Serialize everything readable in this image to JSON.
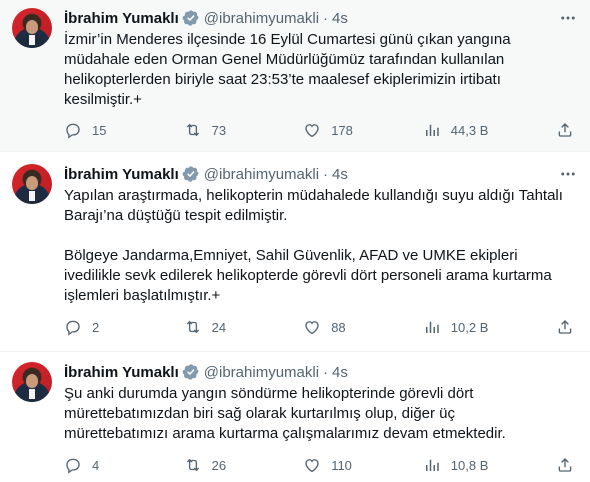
{
  "colors": {
    "text": "#0f1419",
    "muted": "#536471",
    "verified": "#829aab",
    "highlight_bg": "#f7f9f9"
  },
  "icons": {
    "reply": "reply-icon",
    "retweet": "retweet-icon",
    "like": "heart-icon",
    "views": "analytics-icon",
    "share": "share-icon",
    "more": "more-icon",
    "verified": "verified-badge-icon"
  },
  "tweets": [
    {
      "name": "İbrahim Yumaklı",
      "handle": "@ibrahimyumakli",
      "dot": "·",
      "time": "4s",
      "text": "İzmir’in Menderes ilçesinde 16 Eylül Cumartesi günü çıkan yangına\nmüdahale eden Orman Genel Müdürlüğümüz tarafından kullanılan\nhelikopterlerden biriyle saat 23:53’te maalesef ekiplerimizin irtibatı\nkesilmiştir.+",
      "replies": "15",
      "retweets": "73",
      "likes": "178",
      "views": "44,3 B"
    },
    {
      "name": "İbrahim Yumaklı",
      "handle": "@ibrahimyumakli",
      "dot": "·",
      "time": "4s",
      "text": "Yapılan araştırmada, helikopterin müdahalede kullandığı suyu aldığı Tahtalı\nBarajı’na düştüğü tespit edilmiştir.\n\nBölgeye Jandarma,Emniyet, Sahil Güvenlik, AFAD ve UMKE ekipleri\nivedilikle sevk edilerek helikopterde görevli dört personeli arama kurtarma\nişlemleri başlatılmıştır.+",
      "replies": "2",
      "retweets": "24",
      "likes": "88",
      "views": "10,2 B"
    },
    {
      "name": "İbrahim Yumaklı",
      "handle": "@ibrahimyumakli",
      "dot": "·",
      "time": "4s",
      "text": "Şu anki durumda yangın söndürme helikopterinde görevli dört\nmürettebatımızdan biri sağ olarak kurtarılmış olup, diğer üç\nmürettebatımızı arama kurtarma çalışmalarımız devam etmektedir.",
      "replies": "4",
      "retweets": "26",
      "likes": "110",
      "views": "10,8 B"
    }
  ]
}
